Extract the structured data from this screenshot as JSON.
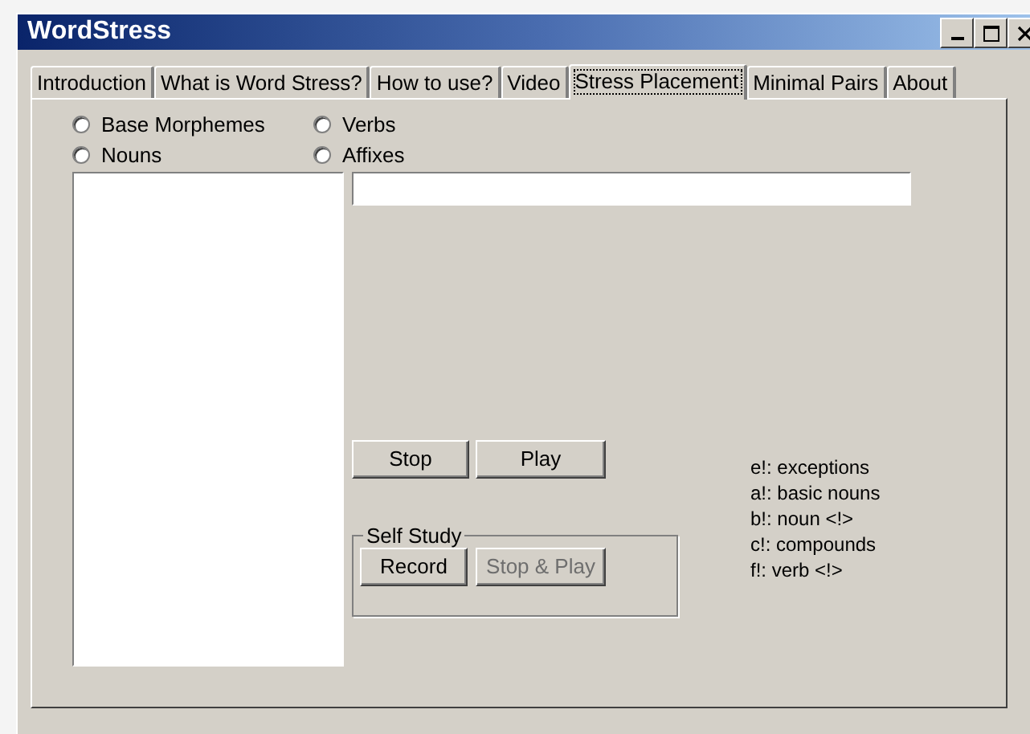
{
  "window": {
    "title": "WordStress"
  },
  "tabs": [
    {
      "label": "Introduction",
      "selected": false
    },
    {
      "label": "What is Word Stress?",
      "selected": false
    },
    {
      "label": "How to use?",
      "selected": false
    },
    {
      "label": "Video",
      "selected": false
    },
    {
      "label": "Stress Placement",
      "selected": true
    },
    {
      "label": "Minimal Pairs",
      "selected": false
    },
    {
      "label": "About",
      "selected": false
    }
  ],
  "radios": [
    {
      "label": "Base Morphemes",
      "selected": false
    },
    {
      "label": "Verbs",
      "selected": false
    },
    {
      "label": "Nouns",
      "selected": false
    },
    {
      "label": "Affixes",
      "selected": false
    }
  ],
  "playback_buttons": [
    {
      "label": "Stop",
      "disabled": false
    },
    {
      "label": "Play",
      "disabled": false
    }
  ],
  "self_study": {
    "title": "Self Study",
    "buttons": [
      {
        "label": "Record",
        "disabled": false
      },
      {
        "label": "Stop & Play",
        "disabled": true
      }
    ]
  },
  "legend": [
    "e!: exceptions",
    "a!: basic nouns",
    "b!: noun <!>",
    "c!: compounds",
    "f!: verb <!>"
  ]
}
